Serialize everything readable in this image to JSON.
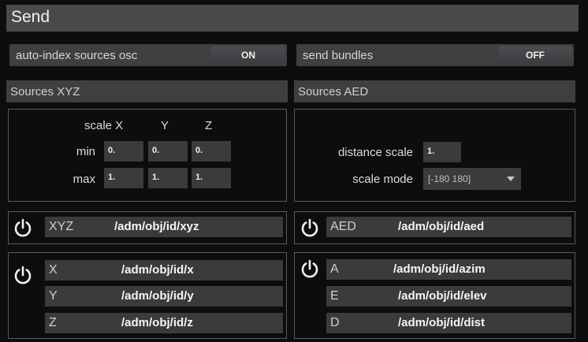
{
  "window": {
    "title": "Send"
  },
  "toggles": {
    "auto_index": {
      "label": "auto-index sources osc",
      "state": "ON"
    },
    "bundles": {
      "label": "send bundles",
      "state": "OFF"
    }
  },
  "xyz": {
    "header": "Sources XYZ",
    "col_headers": [
      "scale X",
      "Y",
      "Z"
    ],
    "min_label": "min",
    "max_label": "max",
    "min": [
      "0.",
      "0.",
      "0."
    ],
    "max": [
      "1.",
      "1.",
      "1."
    ],
    "combined": {
      "key": "XYZ",
      "address": "/adm/obj/id/xyz"
    },
    "separate": [
      {
        "key": "X",
        "address": "/adm/obj/id/x"
      },
      {
        "key": "Y",
        "address": "/adm/obj/id/y"
      },
      {
        "key": "Z",
        "address": "/adm/obj/id/z"
      }
    ]
  },
  "aed": {
    "header": "Sources AED",
    "distance_scale_label": "distance scale",
    "distance_scale": "1.",
    "scale_mode_label": "scale mode",
    "scale_mode": "[-180 180]",
    "combined": {
      "key": "AED",
      "address": "/adm/obj/id/aed"
    },
    "separate": [
      {
        "key": "A",
        "address": "/adm/obj/id/azim"
      },
      {
        "key": "E",
        "address": "/adm/obj/id/elev"
      },
      {
        "key": "D",
        "address": "/adm/obj/id/dist"
      }
    ]
  },
  "icons": {
    "power": "power-icon",
    "dropdown": "chevron-down-icon"
  }
}
